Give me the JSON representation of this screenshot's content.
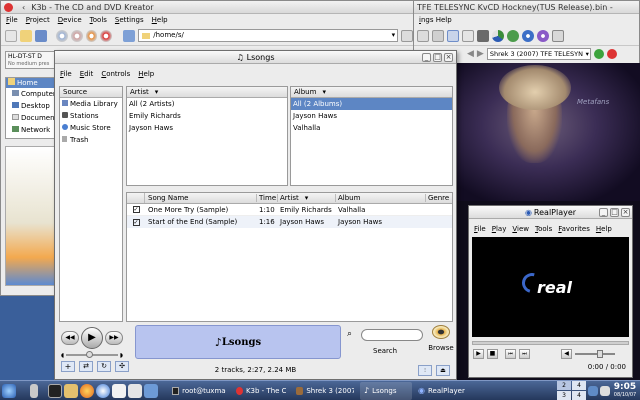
{
  "k3b": {
    "title": "K3b - The CD and DVD Kreator",
    "menu": [
      "File",
      "Project",
      "Device",
      "Tools",
      "Settings",
      "Help"
    ],
    "path_value": "/home/s/",
    "device_label": "HL-DT-ST D",
    "device_status": "No medium pres",
    "tree": [
      "Home",
      "Computer",
      "Desktop",
      "Documen",
      "Network"
    ]
  },
  "kaffeine": {
    "title": "TFE TELESYNC KvCD Hockney(TUS Release).bin -",
    "menu_partial": "ings  Help",
    "channel_select": "Shrek 3 (2007) TFE TELESYN",
    "video_watermark": "Metafans"
  },
  "lsongs": {
    "title": "Lsongs",
    "menu": [
      "File",
      "Edit",
      "Controls",
      "Help"
    ],
    "source_header": "Source",
    "sources": [
      "Media Library",
      "Stations",
      "Music Store",
      "Trash"
    ],
    "artist_header": "Artist",
    "artists": [
      "All (2 Artists)",
      "Emily Richards",
      "Jayson Haws"
    ],
    "album_header": "Album",
    "albums": [
      "All (2 Albums)",
      "Jayson Haws",
      "Valhalla"
    ],
    "track_columns": [
      "Song Name",
      "Time",
      "Artist",
      "Album",
      "Genre"
    ],
    "tracks": [
      {
        "name": "One More Try (Sample)",
        "time": "1:10",
        "artist": "Emily Richards",
        "album": "Valhalla"
      },
      {
        "name": "Start of the End (Sample)",
        "time": "1:16",
        "artist": "Jayson Haws",
        "album": "Jayson Haws"
      }
    ],
    "logo_text": "Lsongs",
    "search_label": "Search",
    "browse_label": "Browse",
    "status_text": "2 tracks, 2:27, 2.24 MB"
  },
  "realplayer": {
    "title": "RealPlayer",
    "menu": [
      "File",
      "Play",
      "View",
      "Tools",
      "Favorites",
      "Help"
    ],
    "logo_text": "real",
    "time_display": "0:00 / 0:00"
  },
  "taskbar": {
    "tasks": [
      "root@tuxmach",
      "K3b - The CD",
      "Shrek 3 (2007)",
      "Lsongs",
      "RealPlayer"
    ],
    "desktops": [
      "2",
      "4",
      "3",
      "4"
    ],
    "clock_time": "9:05",
    "clock_date": "08/10/07"
  },
  "colors": {
    "desktop": "#3a5f9a",
    "selection": "#5d86c4",
    "taskbar": "#2c3f63",
    "lsongs_logo_bg": "#b8c4ef"
  }
}
